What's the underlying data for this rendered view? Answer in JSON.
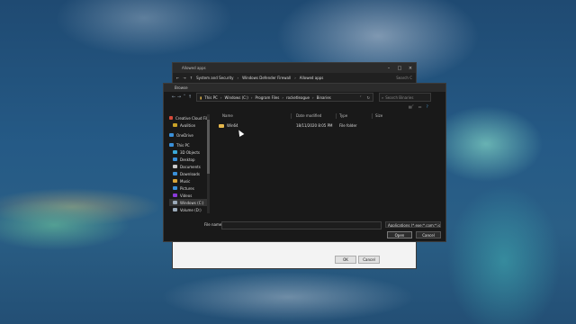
{
  "back_window": {
    "title": "Allowed apps",
    "address": [
      "System and Security",
      "Windows Defender Firewall",
      "Allowed apps"
    ],
    "search_placeholder": "Search C",
    "ok_label": "OK",
    "cancel_label": "Cancel"
  },
  "dialog": {
    "title": "Browse",
    "breadcrumb": [
      "This PC",
      "Windows (C:)",
      "Program Files",
      "rocketleague",
      "Binaries"
    ],
    "search_placeholder": "Search Binaries",
    "sidebar": [
      {
        "label": "Creative Cloud Fil",
        "color": "#d84a3a"
      },
      {
        "label": "Avalition",
        "color": "#c9a227"
      },
      {
        "label": "OneDrive",
        "color": "#3a8fd8"
      },
      {
        "label": "This PC",
        "color": "#3a8fd8"
      },
      {
        "label": "3D Objects",
        "color": "#3aa8d8"
      },
      {
        "label": "Desktop",
        "color": "#3a8fd8"
      },
      {
        "label": "Documents",
        "color": "#c9c9c9"
      },
      {
        "label": "Downloads",
        "color": "#3a8fd8"
      },
      {
        "label": "Music",
        "color": "#d8a43a"
      },
      {
        "label": "Pictures",
        "color": "#3a8fd8"
      },
      {
        "label": "Videos",
        "color": "#8a3ad8"
      },
      {
        "label": "Windows (C:)",
        "color": "#9aa9b8"
      },
      {
        "label": "Volume (D:)",
        "color": "#9aa9b8"
      }
    ],
    "columns": {
      "name": "Name",
      "date": "Date modified",
      "type": "Type",
      "size": "Size"
    },
    "files": [
      {
        "name": "Win64",
        "date": "18/11/2020 8:05 PM",
        "type": "File folder",
        "size": ""
      }
    ],
    "file_name_label": "File name:",
    "file_name_value": "",
    "file_type": "Applications (*.exe;*.com;*.icd)",
    "open_label": "Open",
    "cancel_label": "Cancel"
  }
}
